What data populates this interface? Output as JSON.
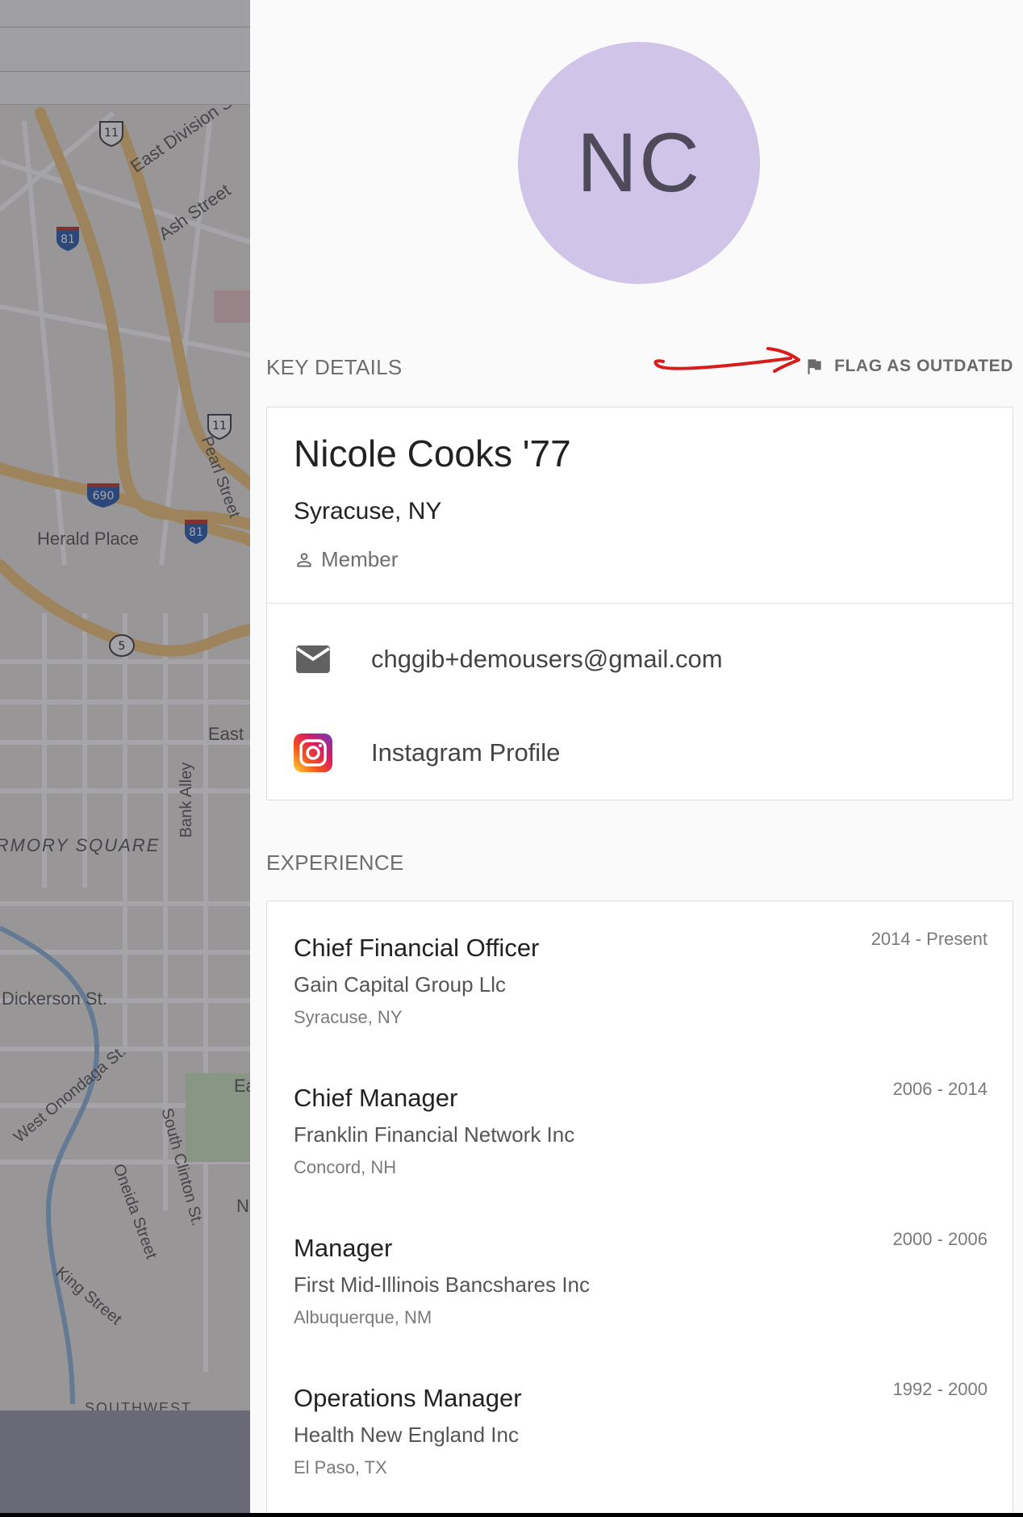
{
  "map": {
    "labels": [
      "East Division St.",
      "Ash Street",
      "Pearl Street",
      "Herald Place",
      "East",
      "ARMORY SQUARE",
      "Bank Alley",
      "Dickerson St.",
      "West Onondaga St.",
      "South Clinton St.",
      "Oneida Street",
      "King Street",
      "SOUTHWEST",
      "Ea",
      "N"
    ],
    "shields": [
      "11",
      "81",
      "11",
      "690",
      "81",
      "5"
    ]
  },
  "profile": {
    "initials": "NC",
    "avatar_color": "#d1c4e9"
  },
  "key_details": {
    "section_title": "KEY DETAILS",
    "flag_label": "FLAG AS OUTDATED",
    "name": "Nicole Cooks '77",
    "location": "Syracuse, NY",
    "role": "Member",
    "email": "chggib+demousers@gmail.com",
    "instagram": "Instagram Profile"
  },
  "experience": {
    "section_title": "EXPERIENCE",
    "items": [
      {
        "title": "Chief Financial Officer",
        "company": "Gain Capital Group Llc",
        "place": "Syracuse, NY",
        "dates": "2014 - Present"
      },
      {
        "title": "Chief Manager",
        "company": "Franklin Financial Network Inc",
        "place": "Concord, NH",
        "dates": "2006 - 2014"
      },
      {
        "title": "Manager",
        "company": "First Mid-Illinois Bancshares Inc",
        "place": "Albuquerque, NM",
        "dates": "2000 - 2006"
      },
      {
        "title": "Operations Manager",
        "company": "Health New England Inc",
        "place": "El Paso, TX",
        "dates": "1992 - 2000"
      }
    ]
  },
  "colors": {
    "annotation_arrow": "#d81b1b",
    "drawer_bg": "#fafafa"
  }
}
